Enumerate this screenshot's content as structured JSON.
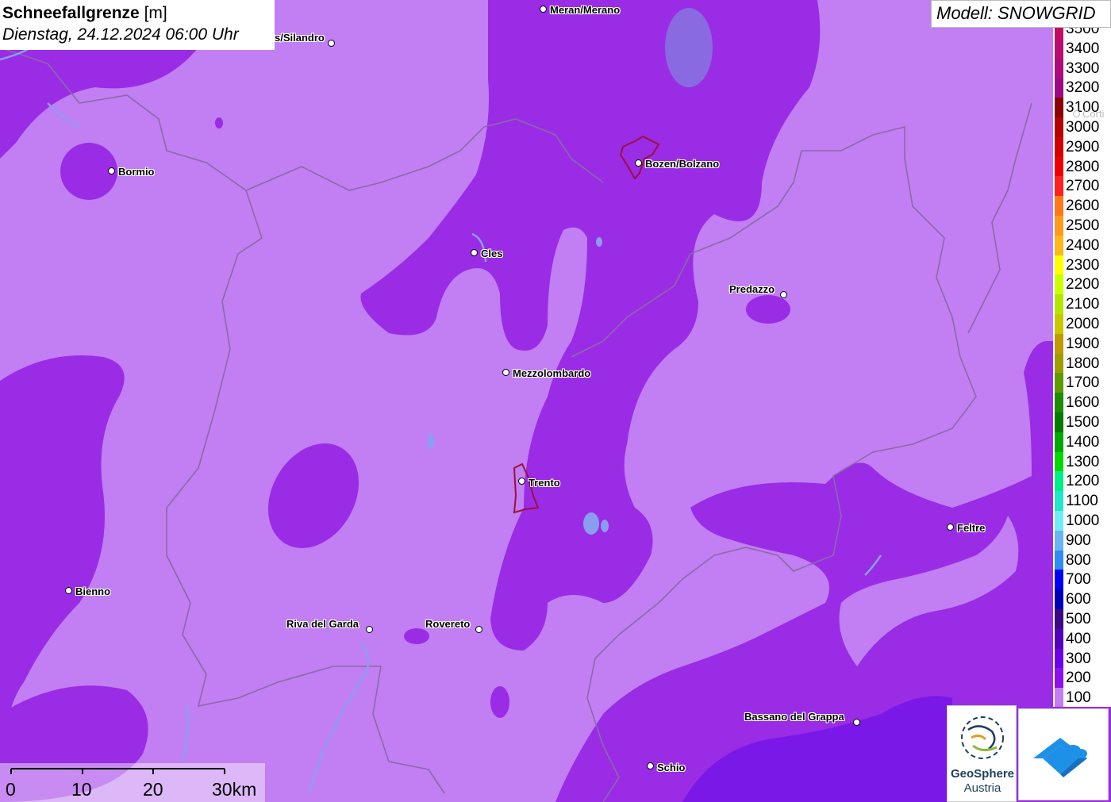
{
  "header": {
    "title_bold": "Schneefallgrenze",
    "title_unit": "[m]",
    "datetime": "Dienstag, 24.12.2024 06:00 Uhr"
  },
  "model": {
    "label": "Modell: SNOWGRID"
  },
  "legend": {
    "items": [
      {
        "label": "3500",
        "color": "#c40d62"
      },
      {
        "label": "3400",
        "color": "#b80e70"
      },
      {
        "label": "3300",
        "color": "#ab0c7c"
      },
      {
        "label": "3200",
        "color": "#9a0a86"
      },
      {
        "label": "3100",
        "color": "#8a0000"
      },
      {
        "label": "3000",
        "color": "#b30000"
      },
      {
        "label": "2900",
        "color": "#d00000"
      },
      {
        "label": "2800",
        "color": "#ee0000"
      },
      {
        "label": "2700",
        "color": "#ff2020"
      },
      {
        "label": "2600",
        "color": "#ff7a1a"
      },
      {
        "label": "2500",
        "color": "#ff9a20"
      },
      {
        "label": "2400",
        "color": "#ffb81a"
      },
      {
        "label": "2300",
        "color": "#ffff00"
      },
      {
        "label": "2200",
        "color": "#ccff00"
      },
      {
        "label": "2100",
        "color": "#b3e600"
      },
      {
        "label": "2000",
        "color": "#c8c800"
      },
      {
        "label": "1900",
        "color": "#c09a00"
      },
      {
        "label": "1800",
        "color": "#9e9c00"
      },
      {
        "label": "1700",
        "color": "#5e9a00"
      },
      {
        "label": "1600",
        "color": "#1e8c00"
      },
      {
        "label": "1500",
        "color": "#007a00"
      },
      {
        "label": "1400",
        "color": "#00a800"
      },
      {
        "label": "1300",
        "color": "#00d800"
      },
      {
        "label": "1200",
        "color": "#00ee88"
      },
      {
        "label": "1100",
        "color": "#22e6c8"
      },
      {
        "label": "1000",
        "color": "#70ecf8"
      },
      {
        "label": "900",
        "color": "#6ab4f4"
      },
      {
        "label": "800",
        "color": "#2e8ef4"
      },
      {
        "label": "700",
        "color": "#0000f4"
      },
      {
        "label": "600",
        "color": "#0000b4"
      },
      {
        "label": "500",
        "color": "#3a0a82"
      },
      {
        "label": "400",
        "color": "#5400b8"
      },
      {
        "label": "300",
        "color": "#6e00e8"
      },
      {
        "label": "200",
        "color": "#8e10e8"
      },
      {
        "label": "100",
        "color": "#c07ef2"
      }
    ]
  },
  "cities": [
    {
      "name": "Meran/Merano"
    },
    {
      "name": "s/Silandro"
    },
    {
      "name": "Bormio"
    },
    {
      "name": "Bozen/Bolzano"
    },
    {
      "name": "Cles"
    },
    {
      "name": "Predazzo"
    },
    {
      "name": "Mezzolombardo"
    },
    {
      "name": "Trento"
    },
    {
      "name": "Feltre"
    },
    {
      "name": "Bienno"
    },
    {
      "name": "Riva del Garda"
    },
    {
      "name": "Rovereto"
    },
    {
      "name": "Bassano del Grappa"
    },
    {
      "name": "Schio"
    },
    {
      "name": "Corti"
    }
  ],
  "scale": {
    "labels": [
      "0",
      "10",
      "20",
      "30km"
    ]
  },
  "logos": {
    "geosphere_line1": "GeoSphere",
    "geosphere_line2": "Austria"
  },
  "colors": {
    "zone_100": "#c27ef3",
    "zone_200": "#9a2ce6",
    "zone_300": "#7a18e8",
    "river": "#8a9ef0",
    "border": "#8a6aa8",
    "city_outline": "#9a1040"
  }
}
